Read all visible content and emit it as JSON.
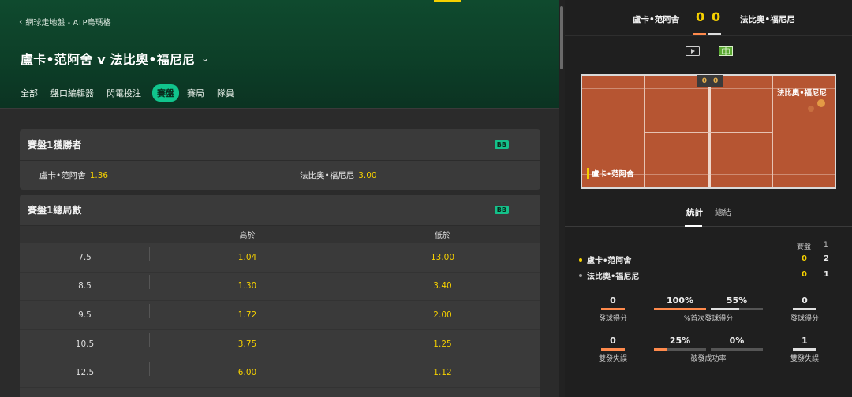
{
  "breadcrumb": {
    "text": "網球走地盤 - ATP烏瑪格"
  },
  "match": {
    "title": "盧卡•范阿舍 v 法比奧•福尼尼"
  },
  "tabs": [
    {
      "label": "全部",
      "active": false
    },
    {
      "label": "盤口編輯器",
      "active": false
    },
    {
      "label": "閃電投注",
      "active": false
    },
    {
      "label": "賽盤",
      "active": true
    },
    {
      "label": "賽局",
      "active": false
    },
    {
      "label": "隊員",
      "active": false
    }
  ],
  "market_winner": {
    "title": "賽盤1獲勝者",
    "badge": "BB",
    "selections": [
      {
        "name": "盧卡•范阿舍",
        "odds": "1.36"
      },
      {
        "name": "法比奧•福尼尼",
        "odds": "3.00"
      }
    ]
  },
  "market_total": {
    "title": "賽盤1總局數",
    "badge": "BB",
    "over_label": "高於",
    "under_label": "低於",
    "rows": [
      {
        "line": "7.5",
        "over": "1.04",
        "under": "13.00"
      },
      {
        "line": "8.5",
        "over": "1.30",
        "under": "3.40"
      },
      {
        "line": "9.5",
        "over": "1.72",
        "under": "2.00"
      },
      {
        "line": "10.5",
        "over": "3.75",
        "under": "1.25"
      },
      {
        "line": "12.5",
        "over": "6.00",
        "under": "1.12"
      }
    ]
  },
  "scoreboard": {
    "player1": "盧卡•范阿舍",
    "player2": "法比奧•福尼尼",
    "score1": "0",
    "score2": "0"
  },
  "view_icons": [
    "play-video-icon",
    "court-view-icon"
  ],
  "court": {
    "score1": "0",
    "score2": "0",
    "player1": "盧卡•范阿舍",
    "player2": "法比奧•福尼尼",
    "surface_color": "#b65532"
  },
  "stat_tabs": {
    "active": "統計",
    "inactive": "總結"
  },
  "set_table": {
    "header_label": "賽盤",
    "header_set": "1",
    "players": [
      {
        "name": "盧卡•范阿舍",
        "dot_color": "#f5d000",
        "sets": "0",
        "games": "2"
      },
      {
        "name": "法比奧•福尼尼",
        "dot_color": "#9a9a9a",
        "sets": "0",
        "games": "1"
      }
    ]
  },
  "stats": {
    "aces_left": {
      "value": "0",
      "label": "發球得分"
    },
    "first_serve_left": {
      "value": "100%",
      "fill": 1.0
    },
    "first_serve_right": {
      "value": "55%",
      "fill": 0.55
    },
    "first_serve_label": "%首次發球得分",
    "aces_right": {
      "value": "0",
      "label": "發球得分"
    },
    "df_left": {
      "value": "0",
      "label": "雙發失誤"
    },
    "bp_left": {
      "value": "25%",
      "fill": 0.25
    },
    "bp_right": {
      "value": "0%",
      "fill": 0.0
    },
    "bp_label": "破發成功率",
    "df_right": {
      "value": "1",
      "label": "雙發失誤"
    },
    "colors": {
      "player1": "#ff8a4c",
      "player2": "#e0e0e0"
    }
  }
}
